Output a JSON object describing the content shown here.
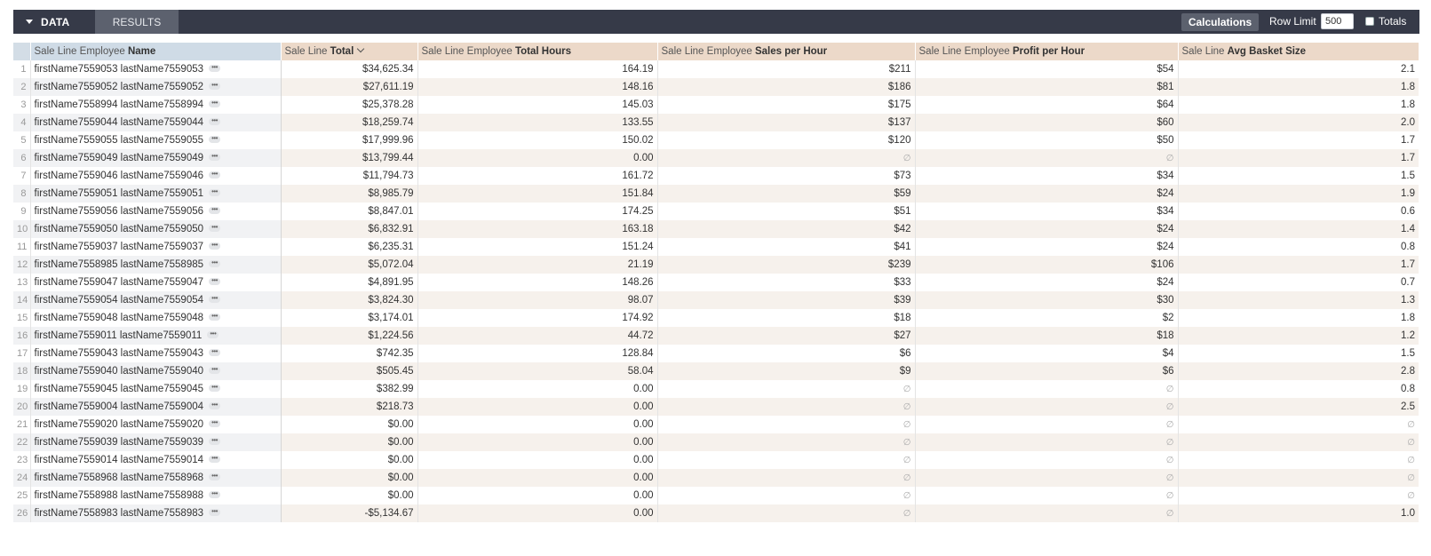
{
  "toolbar": {
    "data_tab": "DATA",
    "results_tab": "RESULTS",
    "calculations": "Calculations",
    "row_limit_label": "Row Limit",
    "row_limit_value": "500",
    "totals_label": "Totals"
  },
  "columns": [
    {
      "prefix": "Sale Line Employee ",
      "bold": "Name"
    },
    {
      "prefix": "Sale Line ",
      "bold": "Total"
    },
    {
      "prefix": "Sale Line Employee ",
      "bold": "Total Hours"
    },
    {
      "prefix": "Sale Line Employee ",
      "bold": "Sales per Hour"
    },
    {
      "prefix": "Sale Line Employee ",
      "bold": "Profit per Hour"
    },
    {
      "prefix": "Sale Line ",
      "bold": "Avg Basket Size"
    }
  ],
  "null_symbol": "∅",
  "ellipsis_symbol": "•••",
  "rows": [
    {
      "n": "1",
      "name": "firstName7559053 lastName7559053",
      "total": "$34,625.34",
      "hours": "164.19",
      "sph": "$211",
      "pph": "$54",
      "basket": "2.1"
    },
    {
      "n": "2",
      "name": "firstName7559052 lastName7559052",
      "total": "$27,611.19",
      "hours": "148.16",
      "sph": "$186",
      "pph": "$81",
      "basket": "1.8"
    },
    {
      "n": "3",
      "name": "firstName7558994 lastName7558994",
      "total": "$25,378.28",
      "hours": "145.03",
      "sph": "$175",
      "pph": "$64",
      "basket": "1.8"
    },
    {
      "n": "4",
      "name": "firstName7559044 lastName7559044",
      "total": "$18,259.74",
      "hours": "133.55",
      "sph": "$137",
      "pph": "$60",
      "basket": "2.0"
    },
    {
      "n": "5",
      "name": "firstName7559055 lastName7559055",
      "total": "$17,999.96",
      "hours": "150.02",
      "sph": "$120",
      "pph": "$50",
      "basket": "1.7"
    },
    {
      "n": "6",
      "name": "firstName7559049 lastName7559049",
      "total": "$13,799.44",
      "hours": "0.00",
      "sph": null,
      "pph": null,
      "basket": "1.7"
    },
    {
      "n": "7",
      "name": "firstName7559046 lastName7559046",
      "total": "$11,794.73",
      "hours": "161.72",
      "sph": "$73",
      "pph": "$34",
      "basket": "1.5"
    },
    {
      "n": "8",
      "name": "firstName7559051 lastName7559051",
      "total": "$8,985.79",
      "hours": "151.84",
      "sph": "$59",
      "pph": "$24",
      "basket": "1.9"
    },
    {
      "n": "9",
      "name": "firstName7559056 lastName7559056",
      "total": "$8,847.01",
      "hours": "174.25",
      "sph": "$51",
      "pph": "$34",
      "basket": "0.6"
    },
    {
      "n": "10",
      "name": "firstName7559050 lastName7559050",
      "total": "$6,832.91",
      "hours": "163.18",
      "sph": "$42",
      "pph": "$24",
      "basket": "1.4"
    },
    {
      "n": "11",
      "name": "firstName7559037 lastName7559037",
      "total": "$6,235.31",
      "hours": "151.24",
      "sph": "$41",
      "pph": "$24",
      "basket": "0.8"
    },
    {
      "n": "12",
      "name": "firstName7558985 lastName7558985",
      "total": "$5,072.04",
      "hours": "21.19",
      "sph": "$239",
      "pph": "$106",
      "basket": "1.7"
    },
    {
      "n": "13",
      "name": "firstName7559047 lastName7559047",
      "total": "$4,891.95",
      "hours": "148.26",
      "sph": "$33",
      "pph": "$24",
      "basket": "0.7"
    },
    {
      "n": "14",
      "name": "firstName7559054 lastName7559054",
      "total": "$3,824.30",
      "hours": "98.07",
      "sph": "$39",
      "pph": "$30",
      "basket": "1.3"
    },
    {
      "n": "15",
      "name": "firstName7559048 lastName7559048",
      "total": "$3,174.01",
      "hours": "174.92",
      "sph": "$18",
      "pph": "$2",
      "basket": "1.8"
    },
    {
      "n": "16",
      "name": "firstName7559011 lastName7559011",
      "total": "$1,224.56",
      "hours": "44.72",
      "sph": "$27",
      "pph": "$18",
      "basket": "1.2"
    },
    {
      "n": "17",
      "name": "firstName7559043 lastName7559043",
      "total": "$742.35",
      "hours": "128.84",
      "sph": "$6",
      "pph": "$4",
      "basket": "1.5"
    },
    {
      "n": "18",
      "name": "firstName7559040 lastName7559040",
      "total": "$505.45",
      "hours": "58.04",
      "sph": "$9",
      "pph": "$6",
      "basket": "2.8"
    },
    {
      "n": "19",
      "name": "firstName7559045 lastName7559045",
      "total": "$382.99",
      "hours": "0.00",
      "sph": null,
      "pph": null,
      "basket": "0.8"
    },
    {
      "n": "20",
      "name": "firstName7559004 lastName7559004",
      "total": "$218.73",
      "hours": "0.00",
      "sph": null,
      "pph": null,
      "basket": "2.5"
    },
    {
      "n": "21",
      "name": "firstName7559020 lastName7559020",
      "total": "$0.00",
      "hours": "0.00",
      "sph": null,
      "pph": null,
      "basket": null
    },
    {
      "n": "22",
      "name": "firstName7559039 lastName7559039",
      "total": "$0.00",
      "hours": "0.00",
      "sph": null,
      "pph": null,
      "basket": null
    },
    {
      "n": "23",
      "name": "firstName7559014 lastName7559014",
      "total": "$0.00",
      "hours": "0.00",
      "sph": null,
      "pph": null,
      "basket": null
    },
    {
      "n": "24",
      "name": "firstName7558968 lastName7558968",
      "total": "$0.00",
      "hours": "0.00",
      "sph": null,
      "pph": null,
      "basket": null
    },
    {
      "n": "25",
      "name": "firstName7558988 lastName7558988",
      "total": "$0.00",
      "hours": "0.00",
      "sph": null,
      "pph": null,
      "basket": null
    },
    {
      "n": "26",
      "name": "firstName7558983 lastName7558983",
      "total": "-$5,134.67",
      "hours": "0.00",
      "sph": null,
      "pph": null,
      "basket": "1.0"
    }
  ]
}
